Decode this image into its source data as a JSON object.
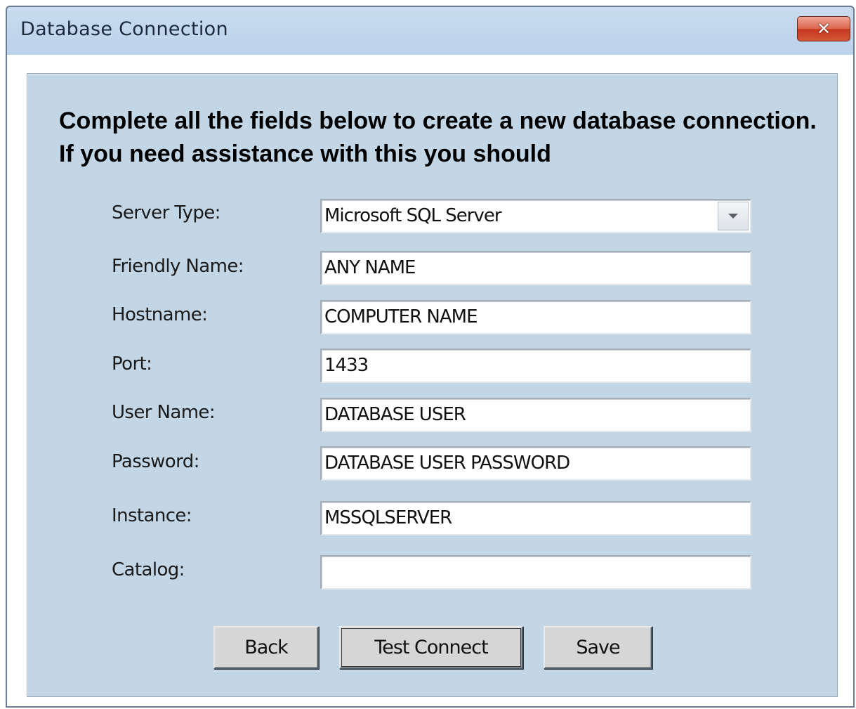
{
  "window": {
    "title": "Database Connection",
    "close_label": "✕"
  },
  "instructions": "Complete all the fields below to create a new database connection. If you need assistance with this you should",
  "form": {
    "server_type": {
      "label": "Server Type:",
      "value": "Microsoft SQL Server"
    },
    "friendly_name": {
      "label": "Friendly Name:",
      "value": "ANY NAME"
    },
    "hostname": {
      "label": "Hostname:",
      "value": "COMPUTER NAME"
    },
    "port": {
      "label": "Port:",
      "value": "1433"
    },
    "user_name": {
      "label": "User Name:",
      "value": "DATABASE USER"
    },
    "password": {
      "label": "Password:",
      "value": "DATABASE USER PASSWORD"
    },
    "instance": {
      "label": "Instance:",
      "value": "MSSQLSERVER"
    },
    "catalog": {
      "label": "Catalog:",
      "value": ""
    }
  },
  "buttons": {
    "back": "Back",
    "test_connect": "Test Connect",
    "save": "Save"
  },
  "icons": {
    "close": "close-icon",
    "dropdown": "chevron-down-icon"
  },
  "colors": {
    "panel_background": "#c3d6e6",
    "close_button": "#d3573a",
    "button_face": "#d6d6d6"
  }
}
